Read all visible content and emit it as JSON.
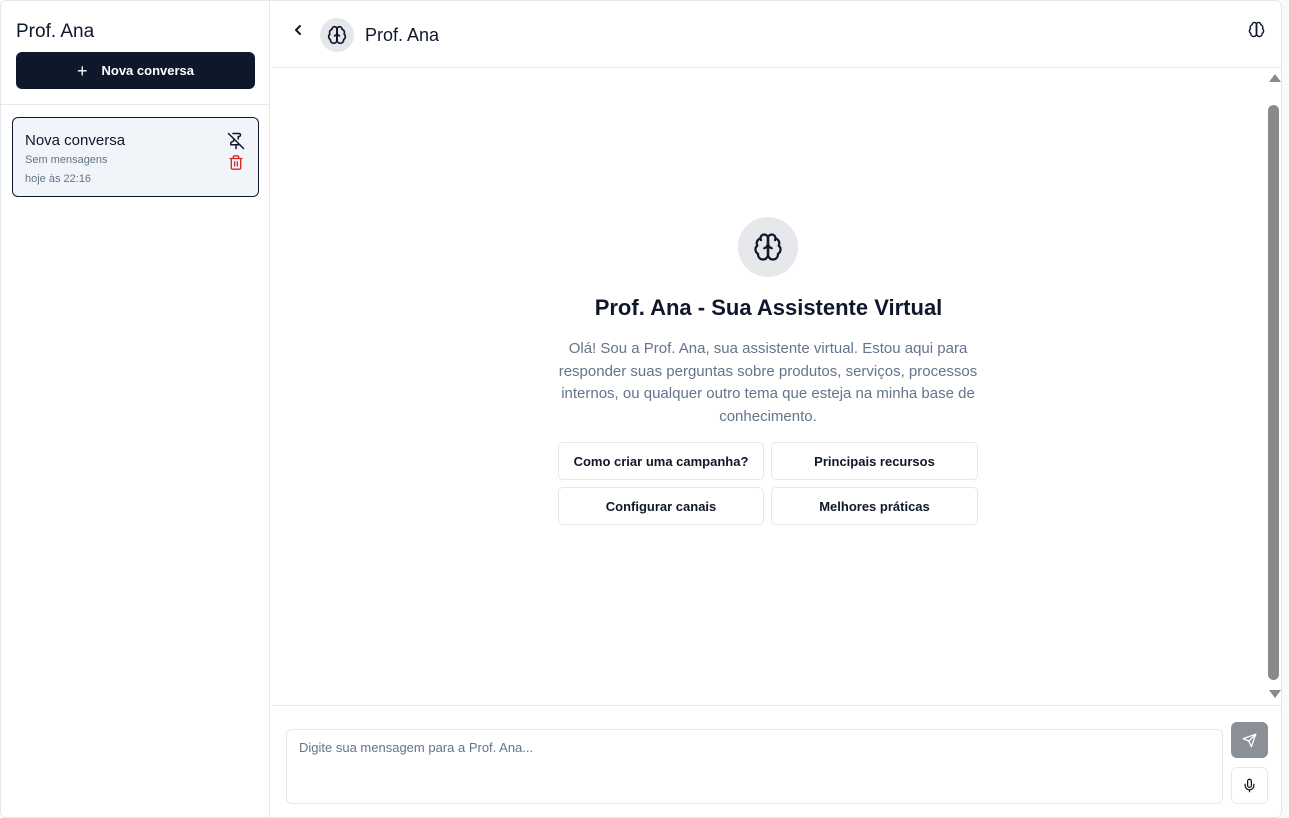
{
  "sidebar": {
    "title": "Prof. Ana",
    "new_button_label": "Nova conversa",
    "conversations": [
      {
        "title": "Nova conversa",
        "subtitle": "Sem mensagens",
        "time": "hoje às 22:16"
      }
    ]
  },
  "header": {
    "title": "Prof. Ana"
  },
  "welcome": {
    "title": "Prof. Ana - Sua Assistente Virtual",
    "description": "Olá! Sou a Prof. Ana, sua assistente virtual. Estou aqui para responder suas perguntas sobre produtos, serviços, processos internos, ou qualquer outro tema que esteja na minha base de conhecimento.",
    "suggestions": [
      "Como criar uma campanha?",
      "Principais recursos",
      "Configurar canais",
      "Melhores práticas"
    ]
  },
  "composer": {
    "placeholder": "Digite sua mensagem para a Prof. Ana...",
    "value": ""
  },
  "icons": {
    "avatar": "brain-icon",
    "back": "chevron-left-icon",
    "pin": "pin-off-icon",
    "delete": "trash-icon",
    "send": "send-icon",
    "mic": "microphone-icon",
    "new": "plus-icon"
  },
  "colors": {
    "primary": "#0f172a",
    "muted_text": "#64748b",
    "danger": "#dc2626",
    "card_bg": "#f1f5f9",
    "send_disabled": "#8b8f96"
  }
}
